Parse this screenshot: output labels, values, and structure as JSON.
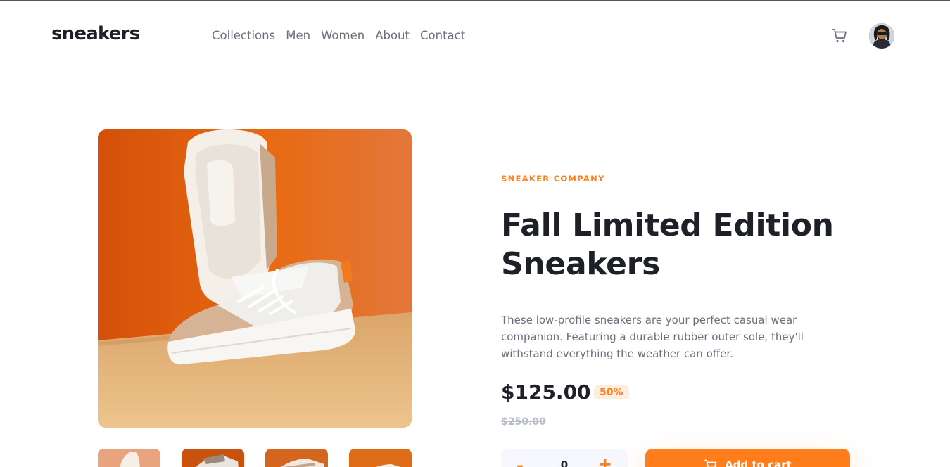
{
  "header": {
    "logo": "sneakers",
    "nav": [
      "Collections",
      "Men",
      "Women",
      "About",
      "Contact"
    ]
  },
  "product": {
    "company": "SNEAKER COMPANY",
    "title": "Fall Limited Edition Sneakers",
    "description": "These low-profile sneakers are your perfect casual wear companion. Featuring a durable rubber outer sole, they'll withstand everything the weather can offer.",
    "price": "$125.00",
    "discount": "50%",
    "old_price": "$250.00"
  },
  "cart": {
    "quantity": "0",
    "minus": "-",
    "plus": "+",
    "add_label": "Add to cart"
  },
  "colors": {
    "accent": "#ff7e1b",
    "accent_pale": "#ffede0",
    "dark": "#1d2026",
    "grey_text": "#69707d"
  },
  "icons": [
    "cart-icon",
    "avatar-image",
    "add-cart-icon"
  ]
}
